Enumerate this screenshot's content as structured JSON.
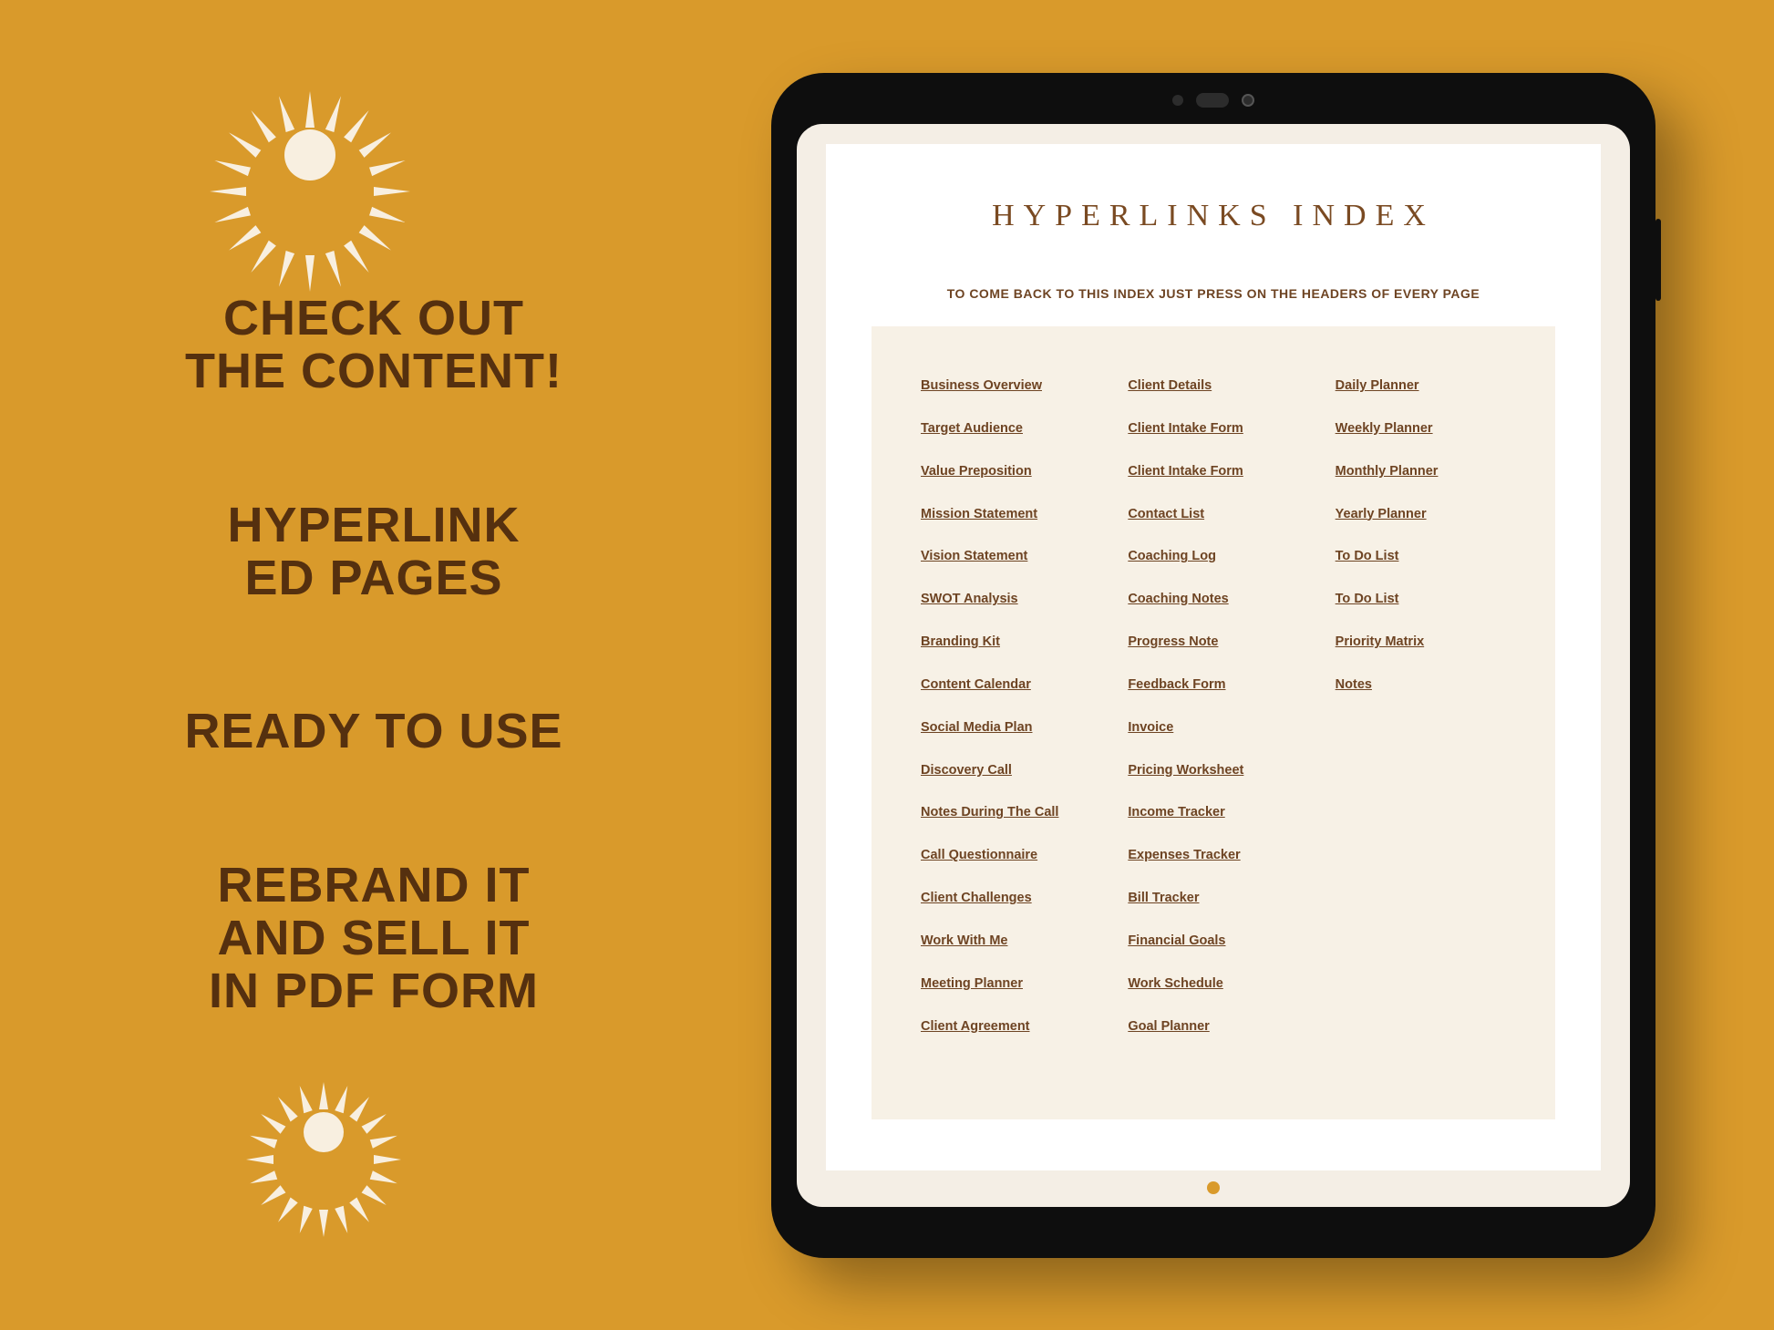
{
  "left": {
    "block1": {
      "line1": "CHECK OUT",
      "line2": "THE CONTENT!"
    },
    "block2": {
      "line1": "HYPERLINK",
      "line2": "ED PAGES"
    },
    "block3": {
      "line1": "READY TO USE"
    },
    "block4": {
      "line1": "REBRAND IT",
      "line2": "AND SELL IT",
      "line3": "IN PDF FORM"
    }
  },
  "tablet": {
    "title": "HYPERLINKS INDEX",
    "subtitle": "TO COME BACK TO THIS INDEX JUST PRESS ON THE HEADERS OF EVERY PAGE",
    "columns": [
      [
        "Business Overview",
        "Target Audience",
        "Value Preposition",
        "Mission Statement",
        "Vision Statement",
        "SWOT Analysis",
        "Branding Kit",
        "Content Calendar",
        "Social Media Plan",
        "Discovery Call",
        "Notes During The Call",
        "Call Questionnaire",
        "Client Challenges",
        "Work With Me",
        "Meeting Planner",
        "Client Agreement"
      ],
      [
        "Client Details",
        "Client Intake Form",
        "Client Intake Form",
        "Contact List",
        "Coaching Log",
        "Coaching Notes",
        "Progress Note",
        "Feedback Form",
        "Invoice",
        "Pricing Worksheet",
        "Income Tracker",
        "Expenses Tracker",
        "Bill Tracker",
        "Financial Goals",
        "Work Schedule",
        "Goal Planner"
      ],
      [
        "Daily Planner",
        "Weekly Planner",
        "Monthly Planner",
        "Yearly Planner",
        "To Do List",
        "To Do List",
        "Priority Matrix",
        "Notes"
      ]
    ]
  },
  "colors": {
    "bg": "#d99a2b",
    "ink": "#55300f",
    "linkInk": "#6e4423",
    "cream": "#f8efe0"
  }
}
